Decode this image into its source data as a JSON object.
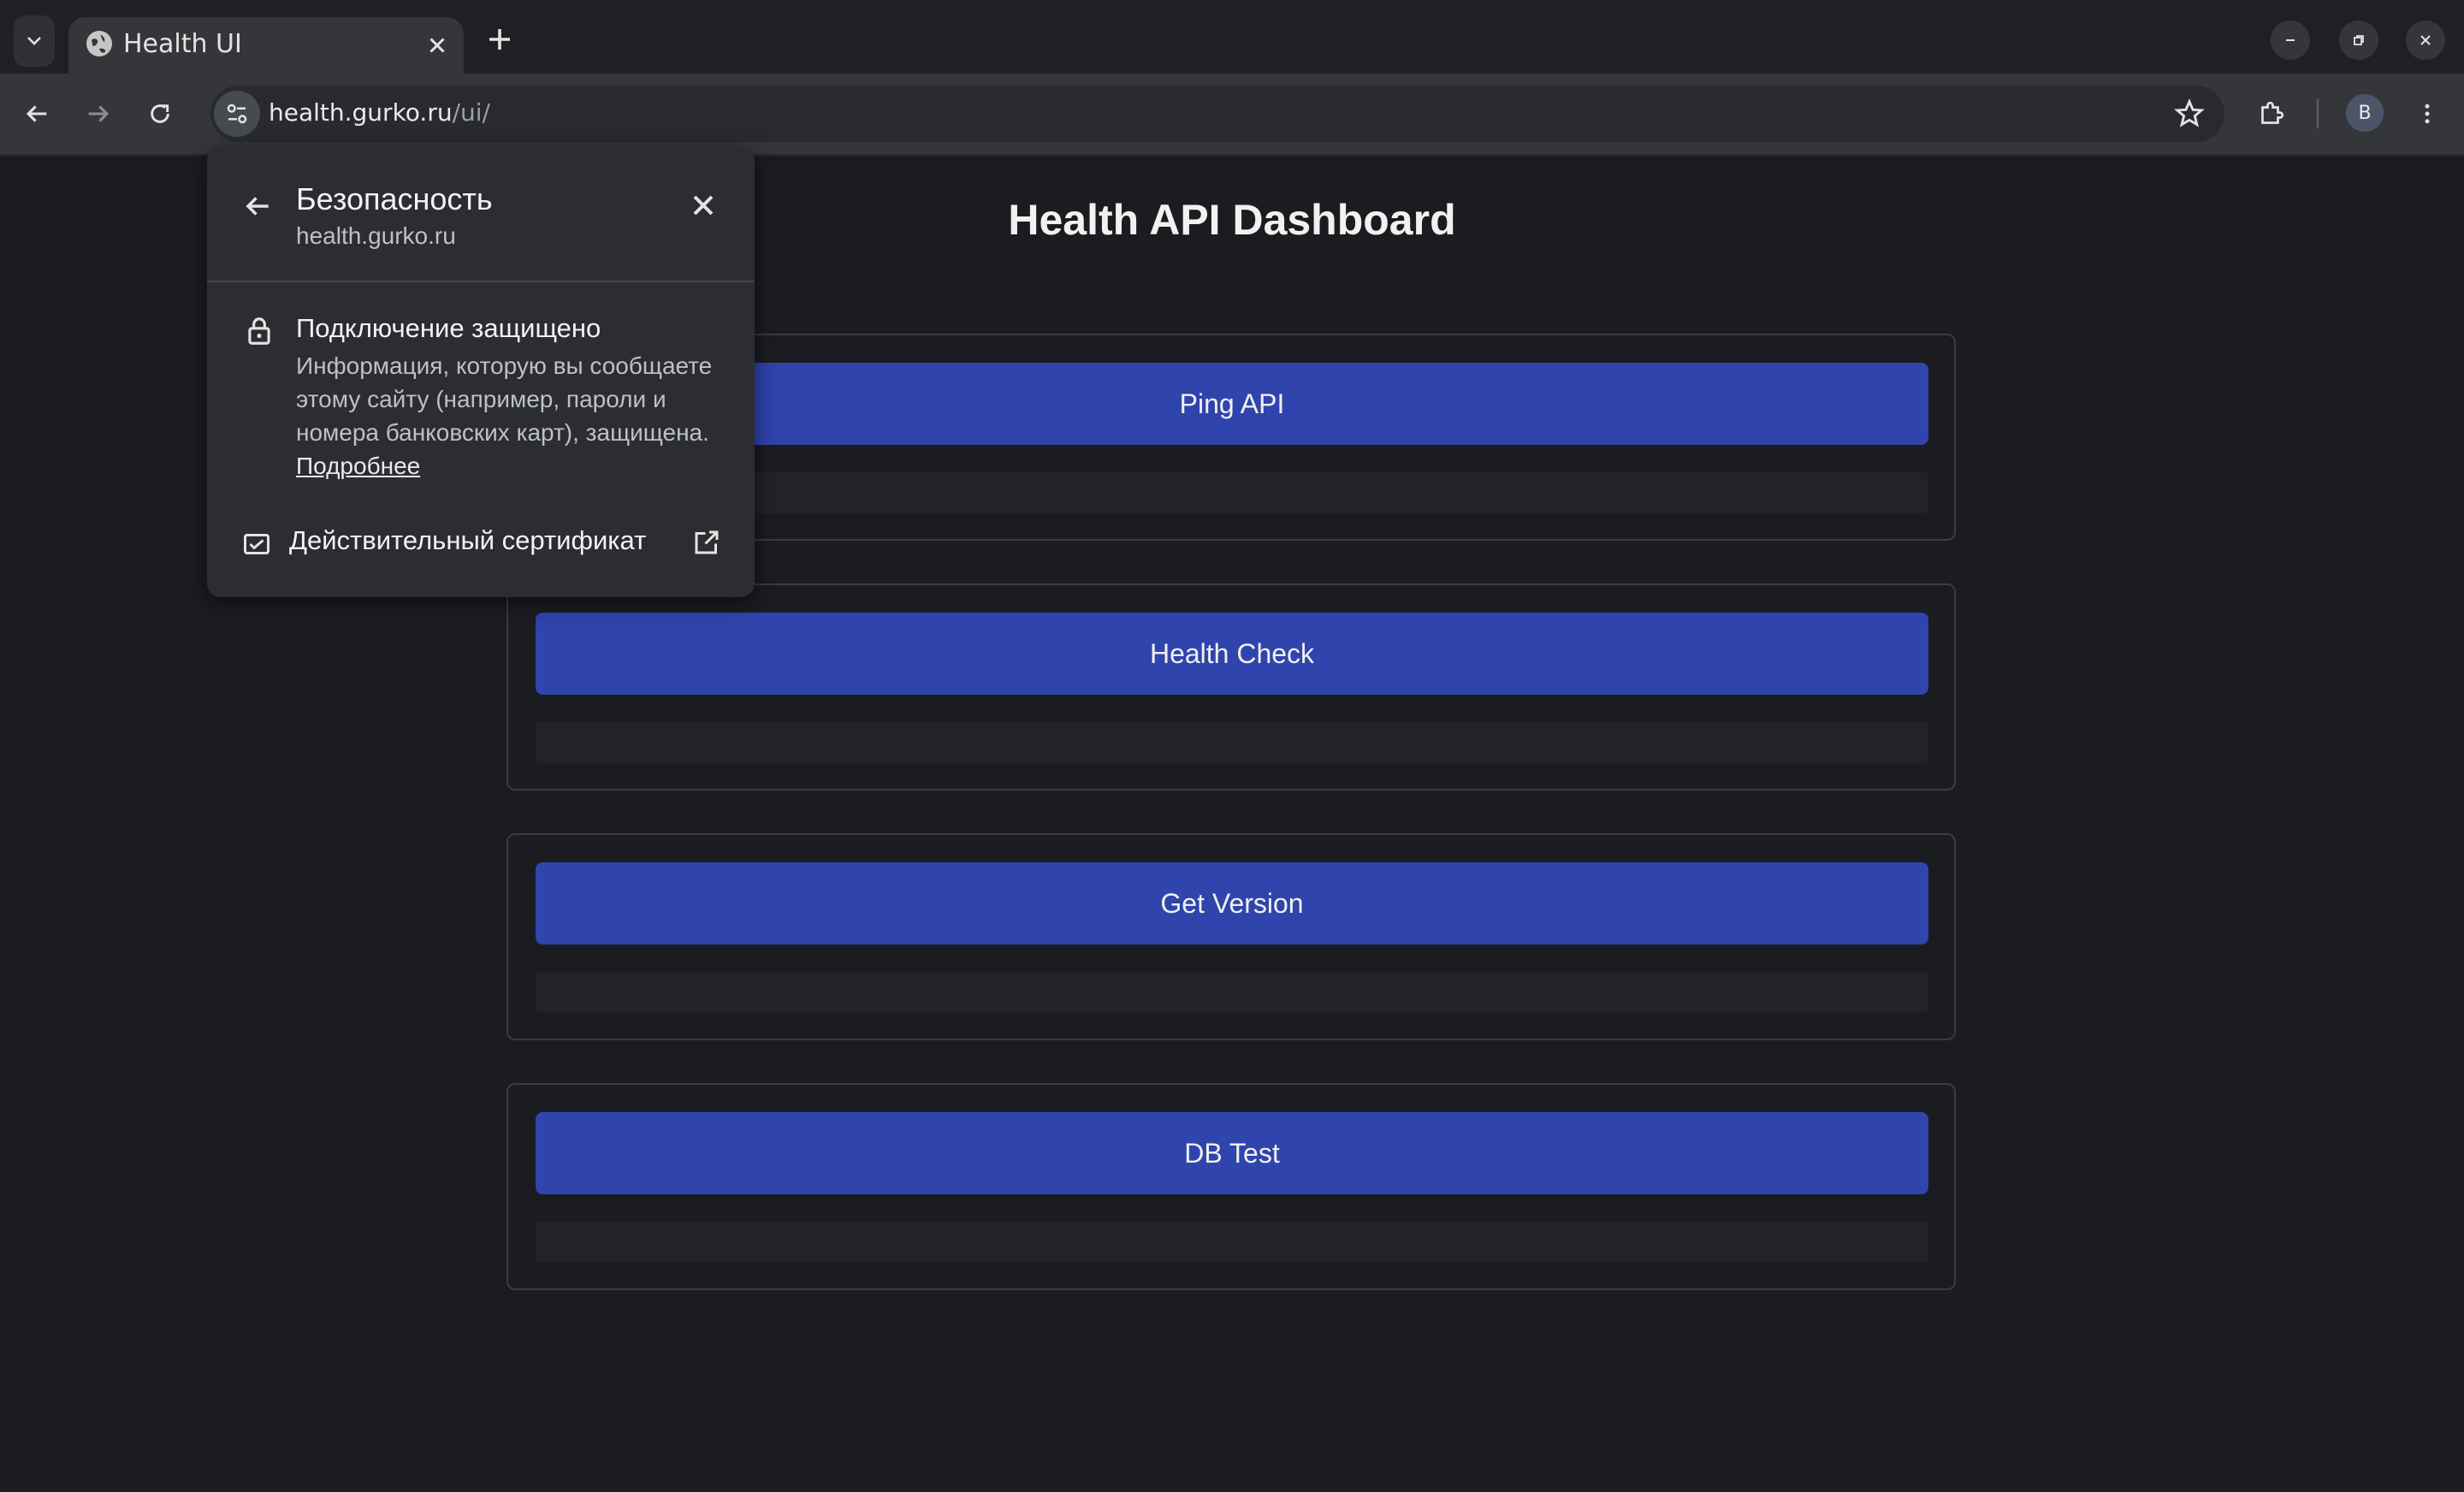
{
  "browser": {
    "tab": {
      "title": "Health UI"
    },
    "address": {
      "host": "health.gurko.ru",
      "path": "/ui/"
    },
    "profile_initial": "B"
  },
  "page": {
    "title": "Health API Dashboard",
    "cards": [
      {
        "button_label": "Ping API"
      },
      {
        "button_label": "Health Check"
      },
      {
        "button_label": "Get Version"
      },
      {
        "button_label": "DB Test"
      }
    ],
    "accent_color": "#2f44ad"
  },
  "security_popup": {
    "heading": "Безопасность",
    "domain": "health.gurko.ru",
    "connection_title": "Подключение защищено",
    "connection_desc": "Информация, которую вы сообщаете этому сайту (например, пароли и номера банковских карт), защищена.",
    "learn_more": "Подробнее",
    "certificate_label": "Действительный сертификат"
  }
}
